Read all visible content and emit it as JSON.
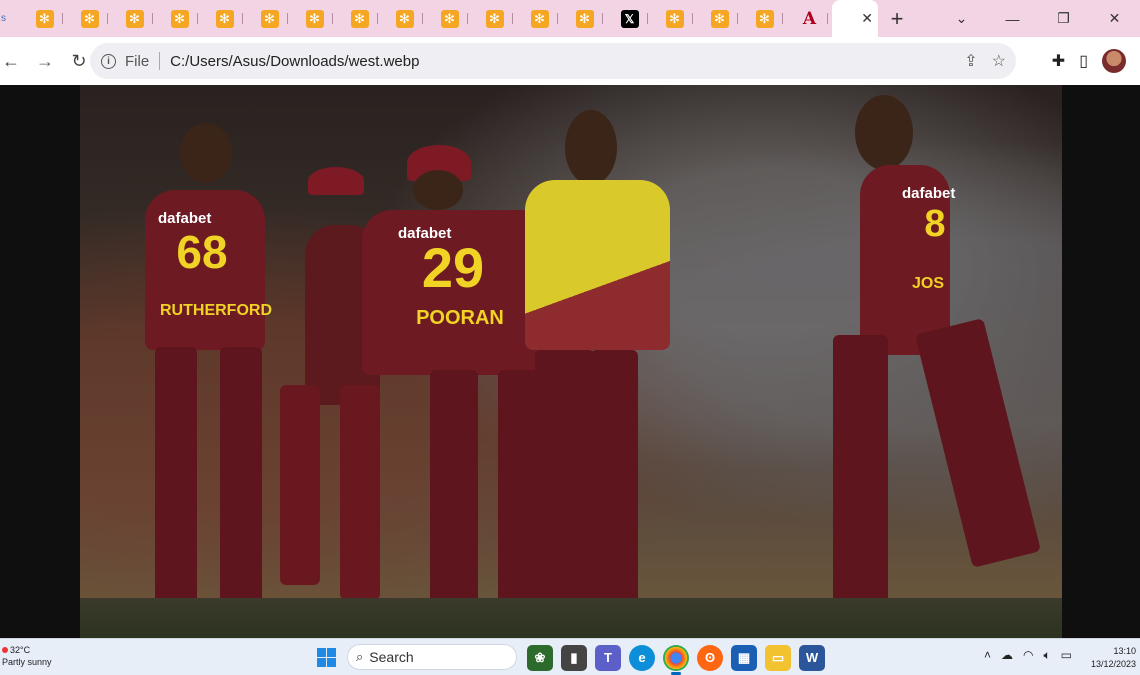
{
  "browser": {
    "tabs": [
      {
        "favicon": "s",
        "type": "partial"
      },
      {
        "favicon": "star-icon",
        "type": "site"
      },
      {
        "favicon": "star-icon",
        "type": "site"
      },
      {
        "favicon": "star-icon",
        "type": "site"
      },
      {
        "favicon": "star-icon",
        "type": "site"
      },
      {
        "favicon": "star-icon",
        "type": "site"
      },
      {
        "favicon": "star-icon",
        "type": "site"
      },
      {
        "favicon": "star-icon",
        "type": "site"
      },
      {
        "favicon": "star-icon",
        "type": "site"
      },
      {
        "favicon": "star-icon",
        "type": "site"
      },
      {
        "favicon": "star-icon",
        "type": "site"
      },
      {
        "favicon": "star-icon",
        "type": "site"
      },
      {
        "favicon": "star-icon",
        "type": "site"
      },
      {
        "favicon": "star-icon",
        "type": "site"
      },
      {
        "favicon": "x-logo-icon",
        "type": "site"
      },
      {
        "favicon": "star-icon",
        "type": "site"
      },
      {
        "favicon": "star-icon",
        "type": "site"
      },
      {
        "favicon": "star-icon",
        "type": "site"
      },
      {
        "favicon": "a-logo-icon",
        "type": "site"
      }
    ],
    "active_tab": {
      "close": "✕"
    },
    "new_tab": "+",
    "window_controls": {
      "dropdown": "⌄",
      "minimize": "—",
      "restore": "❐",
      "close": "✕"
    },
    "address": {
      "scheme": "File",
      "url": "C:/Users/Asus/Downloads/west.webp"
    },
    "accent": "#f3d4e4"
  },
  "photo": {
    "players": [
      {
        "number": "68",
        "name": "RUTHERFORD",
        "sponsor": "dafabet"
      },
      {
        "number": "29",
        "name": "POORAN",
        "sponsor": "dafabet"
      },
      {
        "number": "8",
        "name": "JOS",
        "sponsor": "dafabet"
      }
    ]
  },
  "taskbar": {
    "weather": {
      "temp": "32°C",
      "condition": "Partly sunny"
    },
    "search": "Search",
    "clock": {
      "time": "13:10",
      "date": "13/12/2023"
    }
  }
}
